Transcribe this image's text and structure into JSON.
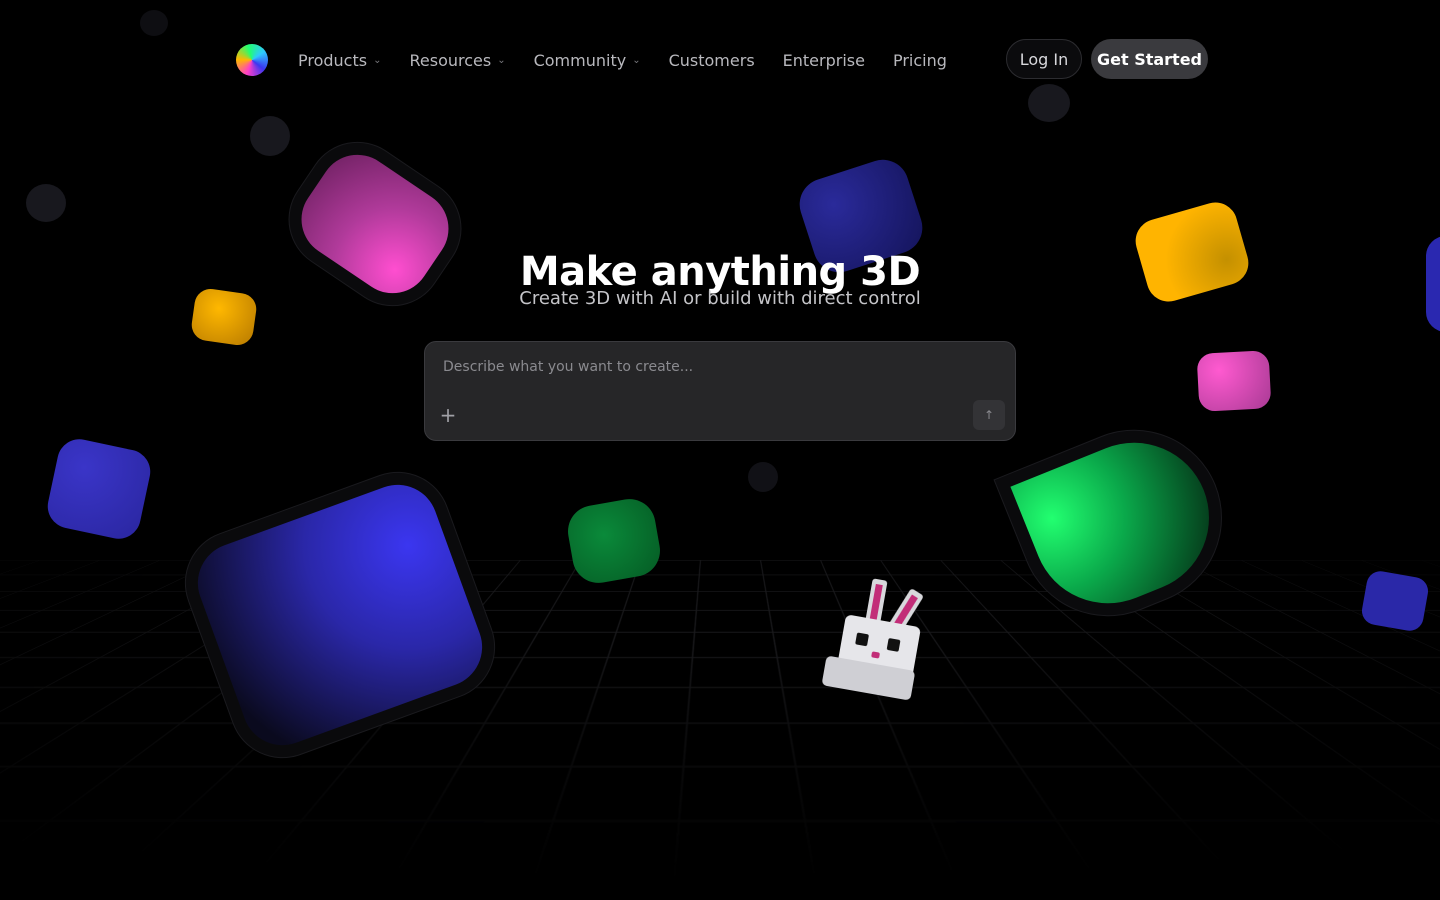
{
  "nav": {
    "logo": "gradient-sphere-logo",
    "items": [
      {
        "label": "Products",
        "has_dropdown": true
      },
      {
        "label": "Resources",
        "has_dropdown": true
      },
      {
        "label": "Community",
        "has_dropdown": true
      },
      {
        "label": "Customers",
        "has_dropdown": false
      },
      {
        "label": "Enterprise",
        "has_dropdown": false
      },
      {
        "label": "Pricing",
        "has_dropdown": false
      }
    ],
    "login_label": "Log In",
    "cta_label": "Get Started"
  },
  "hero": {
    "title": "Make anything 3D",
    "subtitle": "Create 3D with AI or build with direct control"
  },
  "prompt": {
    "placeholder": "Describe what you want to create...",
    "add_icon": "plus-icon",
    "send_icon": "arrow-up-icon"
  },
  "colors": {
    "background": "#000000",
    "accent_pink": "#ff4ed0",
    "accent_yellow": "#ffb800",
    "accent_blue": "#3b36f0",
    "accent_green": "#22ff70"
  }
}
